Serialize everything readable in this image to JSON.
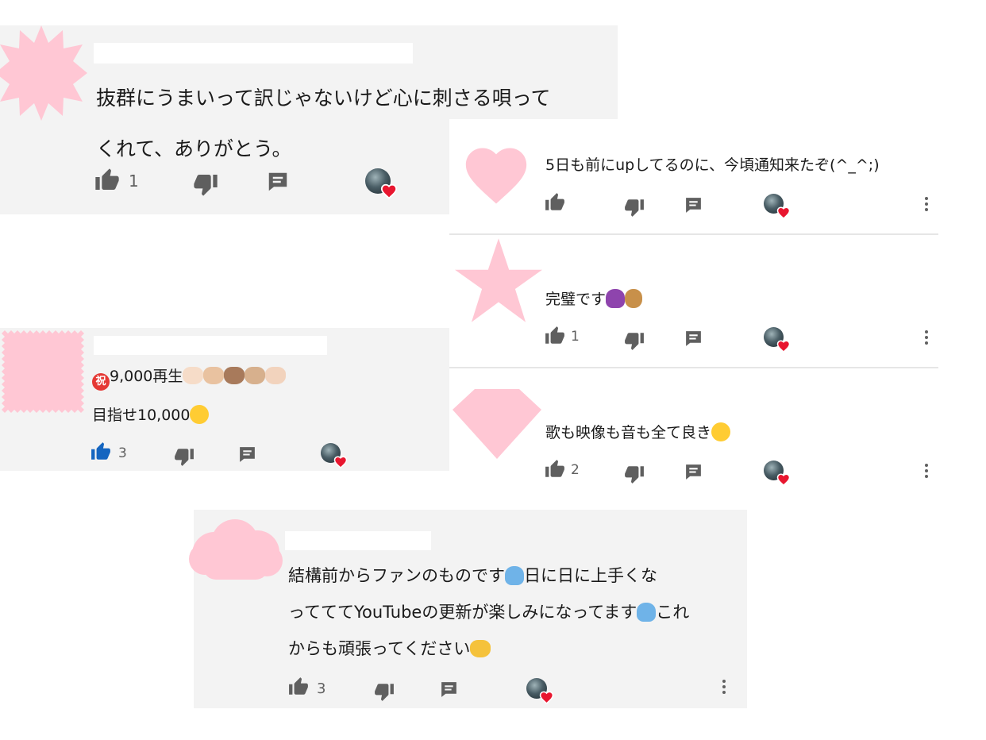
{
  "colors": {
    "card_bg": "#f3f3f3",
    "avatar_pink": "#ffc7d4",
    "icon_grey": "#5f5f5f",
    "like_active_blue": "#1565c0",
    "heart_red": "#e8162f"
  },
  "comments": [
    {
      "id": "c1",
      "avatar_shape": "starburst",
      "text_lines": [
        "抜群にうまいって訳じゃないけど心に刺さる唄って",
        "くれて、ありがとう。"
      ],
      "like_count": "1",
      "liked": false,
      "creator_heart": true
    },
    {
      "id": "c2",
      "avatar_shape": "heart",
      "text_lines": [
        "5日も前にupしてるのに、今頃通知来たぞ(^_^;)"
      ],
      "like_count": "",
      "liked": false,
      "creator_heart": true,
      "menu": true
    },
    {
      "id": "c3",
      "avatar_shape": "star",
      "text_lines": [
        "完璧です"
      ],
      "trailing_emoji": [
        "person-gesturing-ok",
        "peanuts"
      ],
      "like_count": "1",
      "liked": false,
      "creator_heart": true,
      "menu": true
    },
    {
      "id": "c4",
      "avatar_shape": "diamond",
      "text_lines": [
        "歌も映像も音も全て良き"
      ],
      "trailing_emoji": [
        "smiling-face-with-hearts"
      ],
      "like_count": "2",
      "liked": false,
      "creator_heart": true,
      "menu": true
    },
    {
      "id": "c5",
      "avatar_shape": "stamp-square",
      "text_lines": [
        "9,000再生",
        "目指せ10,000"
      ],
      "leading_emoji": [
        "japanese-congratulations-button"
      ],
      "line1_trailing_emoji": [
        "clapping-hands",
        "clapping-hands",
        "clapping-hands",
        "clapping-hands",
        "clapping-hands"
      ],
      "line2_trailing_emoji": [
        "heart-eyes-face"
      ],
      "like_count": "3",
      "liked": true,
      "creator_heart": true
    },
    {
      "id": "c6",
      "avatar_shape": "cloud",
      "text_parts": {
        "l1a": "結構前からファンのものです",
        "l1b": "日に日に上手くな",
        "l2a": "ってててYouTubeの更新が楽しみになってます",
        "l2b": "これ",
        "l3a": "からも頑張ってください"
      },
      "like_count": "3",
      "liked": false,
      "creator_heart": true,
      "menu": true
    }
  ],
  "emoji_glyphs": {
    "iwai": "祝"
  }
}
